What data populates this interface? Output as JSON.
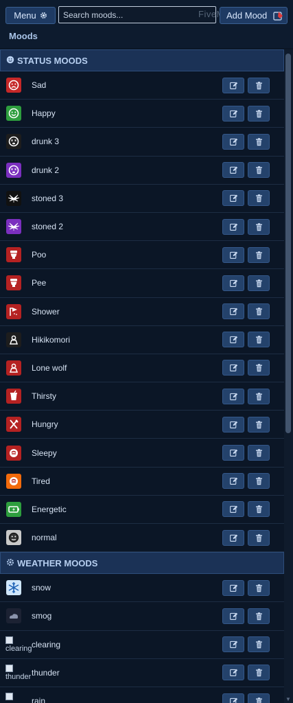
{
  "header": {
    "menu_label": "Menu",
    "search_placeholder": "Search moods...",
    "add_label": "Add Mood",
    "watermark": "FiveM",
    "page_title": "Moods"
  },
  "sections": [
    {
      "title": "STATUS MOODS",
      "icon": "smiley-icon",
      "items": [
        {
          "name": "Sad",
          "icon": "sad-face-icon",
          "bg": "#c62828"
        },
        {
          "name": "Happy",
          "icon": "happy-face-icon",
          "bg": "#2e9e3e"
        },
        {
          "name": "drunk 3",
          "icon": "dizzy-face-icon",
          "bg": "#1d1d1d"
        },
        {
          "name": "drunk 2",
          "icon": "dizzy-face-icon",
          "bg": "#7b2fbf"
        },
        {
          "name": "stoned 3",
          "icon": "cannabis-leaf-icon",
          "bg": "#111111"
        },
        {
          "name": "stoned 2",
          "icon": "cannabis-leaf-icon",
          "bg": "#7b2fbf"
        },
        {
          "name": "Poo",
          "icon": "toilet-icon",
          "bg": "#b52222"
        },
        {
          "name": "Pee",
          "icon": "toilet-icon",
          "bg": "#b52222"
        },
        {
          "name": "Shower",
          "icon": "shower-icon",
          "bg": "#b52222"
        },
        {
          "name": "Hikikomori",
          "icon": "person-alone-icon",
          "bg": "#1d1d1d"
        },
        {
          "name": "Lone wolf",
          "icon": "person-alone-icon",
          "bg": "#b52222"
        },
        {
          "name": "Thirsty",
          "icon": "cup-icon",
          "bg": "#b52222"
        },
        {
          "name": "Hungry",
          "icon": "fork-knife-icon",
          "bg": "#b52222"
        },
        {
          "name": "Sleepy",
          "icon": "bed-icon",
          "bg": "#b52222"
        },
        {
          "name": "Tired",
          "icon": "bed-icon",
          "bg": "#f26a0c"
        },
        {
          "name": "Energetic",
          "icon": "battery-icon",
          "bg": "#2e9e3e"
        },
        {
          "name": "normal",
          "icon": "neutral-face-icon",
          "bg": "#c9c9c9"
        }
      ]
    },
    {
      "title": "WEATHER MOODS",
      "icon": "gear-icon",
      "items": [
        {
          "name": "snow",
          "icon": "snowflake-icon",
          "bg": "#cfe6fb"
        },
        {
          "name": "smog",
          "icon": "cloud-icon",
          "bg": "#1c2233"
        },
        {
          "name": "clearing",
          "icon": "broken-image-icon",
          "bg": "",
          "alt": "clearing"
        },
        {
          "name": "thunder",
          "icon": "broken-image-icon",
          "bg": "",
          "alt": "thunder"
        },
        {
          "name": "rain",
          "icon": "broken-image-icon",
          "bg": "",
          "alt": ""
        }
      ]
    }
  ]
}
